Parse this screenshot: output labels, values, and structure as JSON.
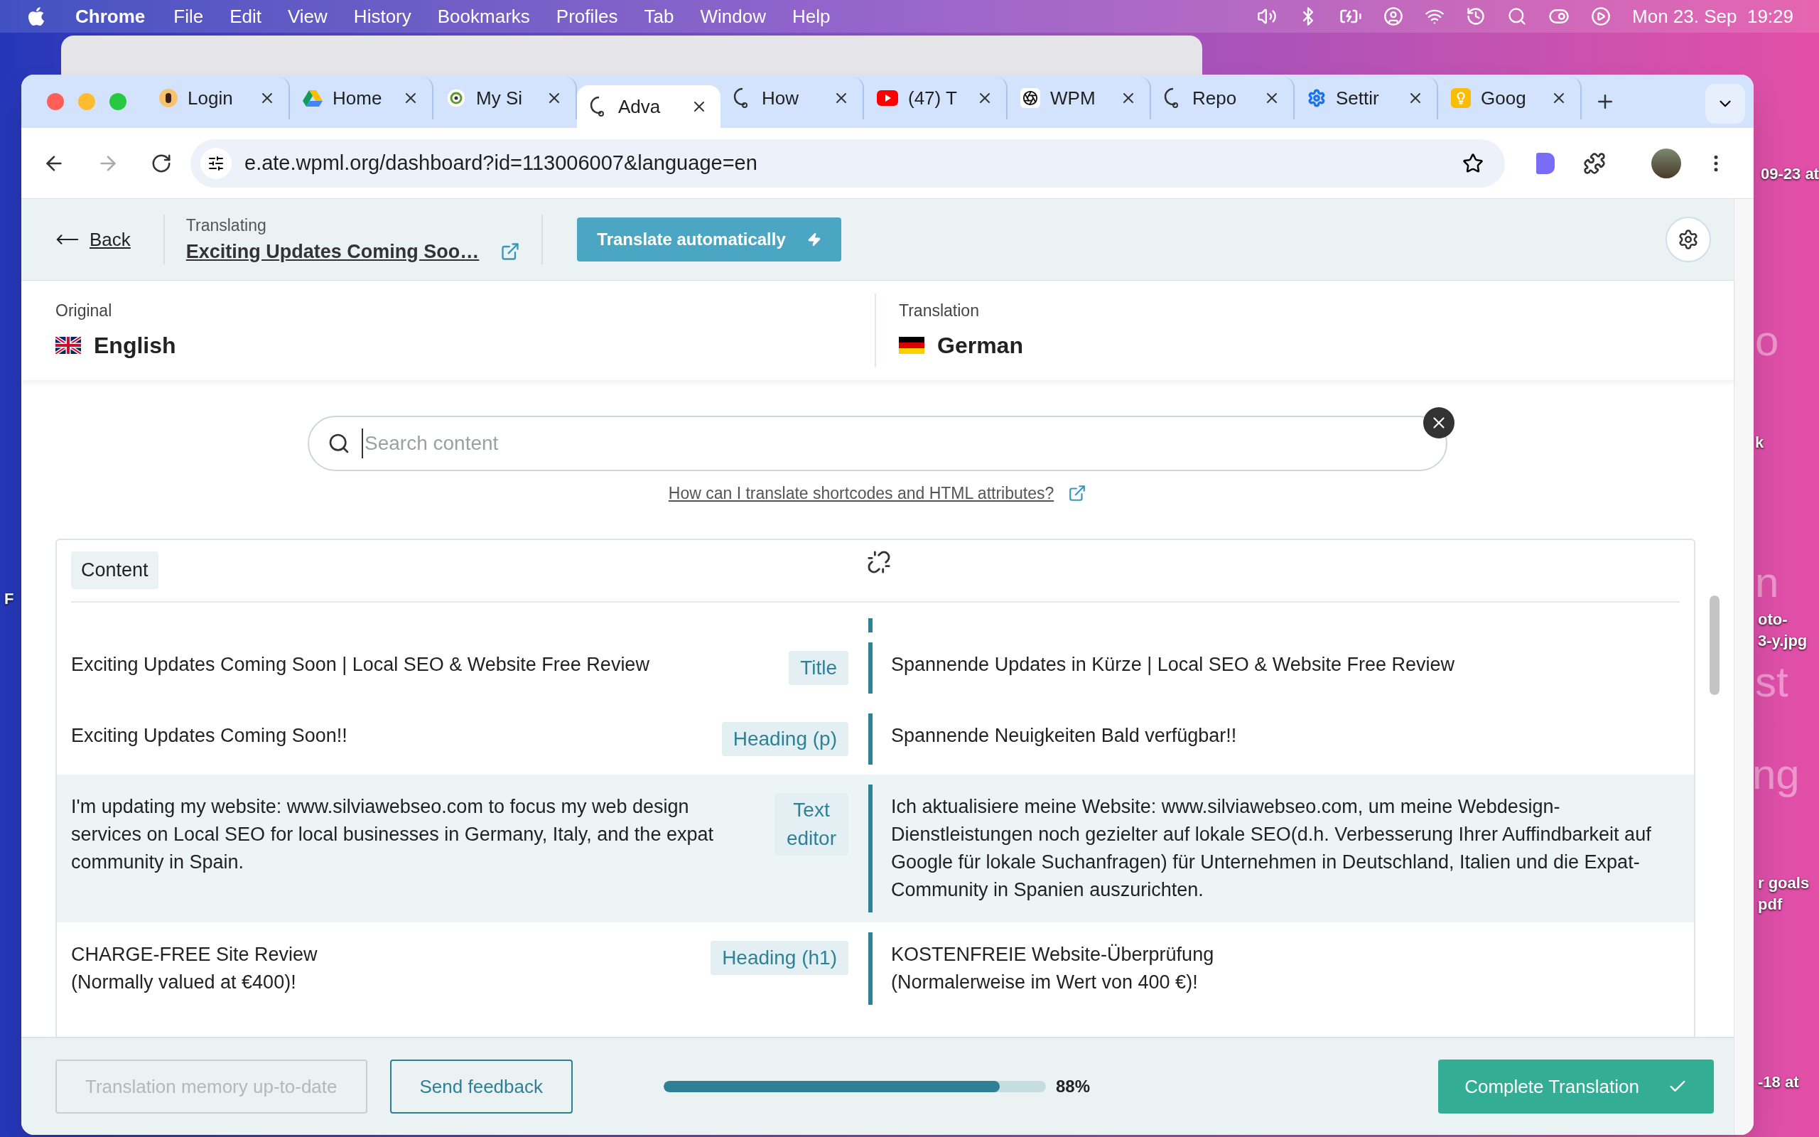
{
  "menu_bar": {
    "app": "Chrome",
    "items": [
      "File",
      "Edit",
      "View",
      "History",
      "Bookmarks",
      "Profiles",
      "Tab",
      "Window",
      "Help"
    ],
    "clock": "Mon 23. Sep  19:29"
  },
  "desktop": {
    "labels": [
      "09-23 at",
      "k",
      "oto-",
      "3-y.jpg",
      "r goals",
      "pdf",
      "-18 at",
      "F"
    ],
    "wallpaper_text": [
      "o",
      "n",
      "st",
      "ng"
    ]
  },
  "tabs": [
    {
      "title": "Login",
      "kind": "letter",
      "selected": false
    },
    {
      "title": "Home",
      "kind": "drive",
      "selected": false
    },
    {
      "title": "My Si",
      "kind": "ring",
      "selected": false
    },
    {
      "title": "Adva",
      "kind": "wpml",
      "selected": true
    },
    {
      "title": "How",
      "kind": "wpml",
      "selected": false
    },
    {
      "title": "(47) T",
      "kind": "video",
      "selected": false
    },
    {
      "title": "WPM",
      "kind": "knot",
      "selected": false
    },
    {
      "title": "Repo",
      "kind": "wpml",
      "selected": false
    },
    {
      "title": "Settir",
      "kind": "gear",
      "selected": false
    },
    {
      "title": "Goog",
      "kind": "bulb",
      "selected": false
    }
  ],
  "address": "e.ate.wpml.org/dashboard?id=113006007&language=en",
  "header": {
    "back": "Back",
    "context": "Translating",
    "title": "Exciting Updates Coming Soo…",
    "auto_button": "Translate automatically"
  },
  "languages": {
    "original_label": "Original",
    "original": "English",
    "translation_label": "Translation",
    "translation": "German"
  },
  "search": {
    "placeholder": "Search content"
  },
  "help_link": "How can I translate shortcodes and HTML attributes?",
  "table": {
    "header": "Content",
    "rows": [
      {
        "source": "Exciting Updates Coming Soon | Local SEO & Website Free Review",
        "tag": "Title",
        "target": "Spannende Updates in Kürze | Local SEO & Website Free Review",
        "selected": false
      },
      {
        "source": "Exciting Updates Coming Soon!!",
        "tag": "Heading (p)",
        "target": "Spannende Neuigkeiten Bald verfügbar!!",
        "selected": false
      },
      {
        "source": "I'm updating my website: www.silviawebseo.com to focus my web design services on Local SEO for local businesses in Germany, Italy, and the expat community in Spain.",
        "tag": "Text editor",
        "target": "Ich aktualisiere meine Website: www.silviawebseo.com, um meine Webdesign-Dienstleistungen noch gezielter auf lokale SEO(d.h. Verbesserung Ihrer Auffindbarkeit auf Google für lokale Suchanfragen) für Unternehmen in Deutschland, Italien und die Expat-Community in Spanien auszurichten.",
        "selected": true
      },
      {
        "source": "CHARGE-FREE Site Review\n(Normally valued at €400)!",
        "tag": "Heading (h1)",
        "target": "KOSTENFREIE Website-Überprüfung\n(Normalerweise im Wert von 400 €)!",
        "selected": false
      }
    ]
  },
  "footer": {
    "memory_button": {
      "label": "Translation memory up-to-date",
      "disabled": true
    },
    "feedback": "Send feedback",
    "progress": {
      "level": 0.88,
      "reading": "88%"
    },
    "complete": "Complete Translation"
  }
}
